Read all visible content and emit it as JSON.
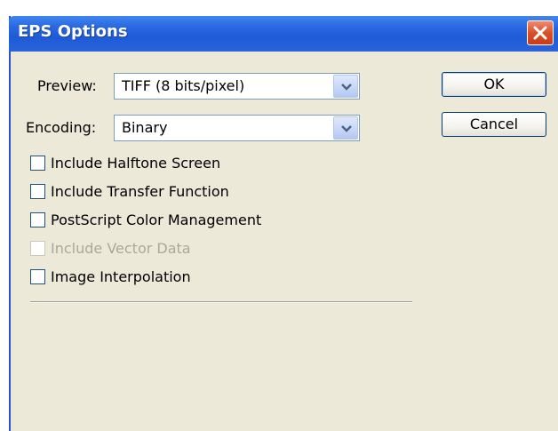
{
  "window": {
    "title": "EPS Options"
  },
  "form": {
    "preview_label": "Preview:",
    "preview_value": "TIFF  (8 bits/pixel)",
    "encoding_label": "Encoding:",
    "encoding_value": "Binary"
  },
  "buttons": {
    "ok_label": "OK",
    "cancel_label": "Cancel"
  },
  "options": [
    {
      "label": "Include Halftone Screen",
      "checked": false,
      "enabled": true
    },
    {
      "label": "Include Transfer Function",
      "checked": false,
      "enabled": true
    },
    {
      "label": "PostScript Color Management",
      "checked": false,
      "enabled": true
    },
    {
      "label": "Include Vector Data",
      "checked": false,
      "enabled": false
    },
    {
      "label": "Image Interpolation",
      "checked": false,
      "enabled": true
    }
  ],
  "colors": {
    "titlebar": "#2a68e0",
    "dialog_background": "#ece9d8",
    "close_button": "#d9502a",
    "disabled_text": "#aca899"
  }
}
